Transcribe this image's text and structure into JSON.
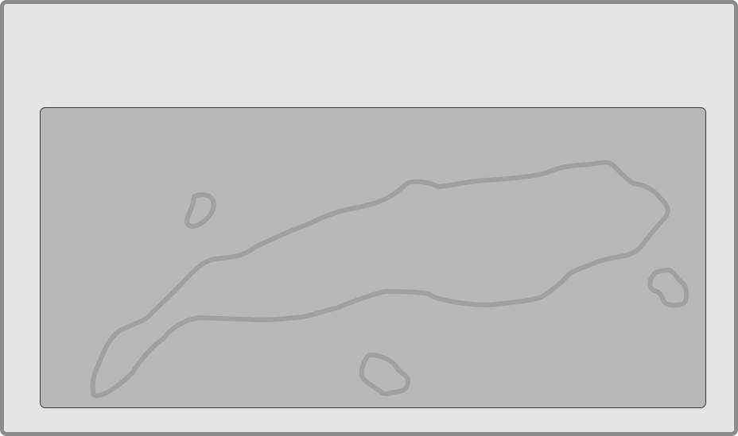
{
  "colors": {
    "window_bg": "#e6e6e6",
    "window_border": "#8c8c8c",
    "canvas_bg": "#b8b8b8",
    "canvas_border": "#3a3a3a",
    "outline": "#a0a0a0"
  },
  "canvas": {
    "shapes": [
      {
        "name": "main-island-outline"
      },
      {
        "name": "small-island-outline-top-left"
      },
      {
        "name": "small-island-outline-bottom"
      },
      {
        "name": "small-island-outline-right"
      }
    ]
  }
}
